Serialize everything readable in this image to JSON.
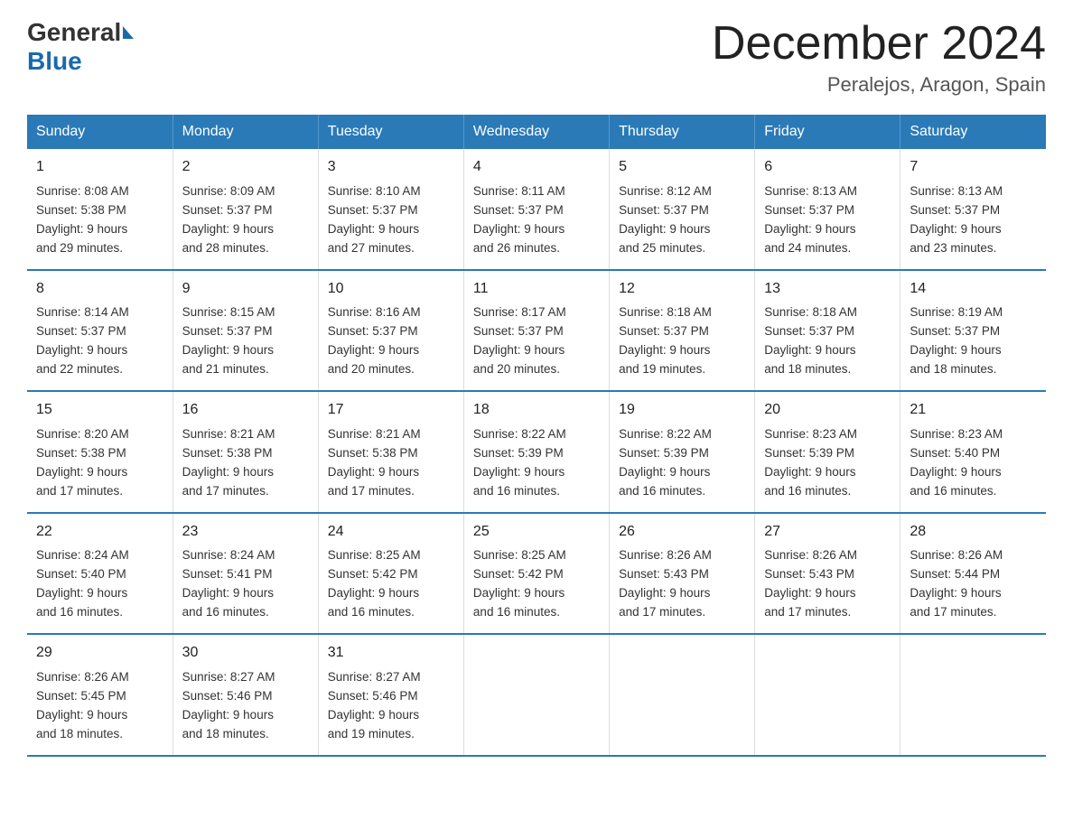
{
  "header": {
    "logo_general": "General",
    "logo_blue": "Blue",
    "month": "December 2024",
    "location": "Peralejos, Aragon, Spain"
  },
  "weekdays": [
    "Sunday",
    "Monday",
    "Tuesday",
    "Wednesday",
    "Thursday",
    "Friday",
    "Saturday"
  ],
  "weeks": [
    [
      {
        "day": "1",
        "sunrise": "8:08 AM",
        "sunset": "5:38 PM",
        "daylight": "9 hours and 29 minutes."
      },
      {
        "day": "2",
        "sunrise": "8:09 AM",
        "sunset": "5:37 PM",
        "daylight": "9 hours and 28 minutes."
      },
      {
        "day": "3",
        "sunrise": "8:10 AM",
        "sunset": "5:37 PM",
        "daylight": "9 hours and 27 minutes."
      },
      {
        "day": "4",
        "sunrise": "8:11 AM",
        "sunset": "5:37 PM",
        "daylight": "9 hours and 26 minutes."
      },
      {
        "day": "5",
        "sunrise": "8:12 AM",
        "sunset": "5:37 PM",
        "daylight": "9 hours and 25 minutes."
      },
      {
        "day": "6",
        "sunrise": "8:13 AM",
        "sunset": "5:37 PM",
        "daylight": "9 hours and 24 minutes."
      },
      {
        "day": "7",
        "sunrise": "8:13 AM",
        "sunset": "5:37 PM",
        "daylight": "9 hours and 23 minutes."
      }
    ],
    [
      {
        "day": "8",
        "sunrise": "8:14 AM",
        "sunset": "5:37 PM",
        "daylight": "9 hours and 22 minutes."
      },
      {
        "day": "9",
        "sunrise": "8:15 AM",
        "sunset": "5:37 PM",
        "daylight": "9 hours and 21 minutes."
      },
      {
        "day": "10",
        "sunrise": "8:16 AM",
        "sunset": "5:37 PM",
        "daylight": "9 hours and 20 minutes."
      },
      {
        "day": "11",
        "sunrise": "8:17 AM",
        "sunset": "5:37 PM",
        "daylight": "9 hours and 20 minutes."
      },
      {
        "day": "12",
        "sunrise": "8:18 AM",
        "sunset": "5:37 PM",
        "daylight": "9 hours and 19 minutes."
      },
      {
        "day": "13",
        "sunrise": "8:18 AM",
        "sunset": "5:37 PM",
        "daylight": "9 hours and 18 minutes."
      },
      {
        "day": "14",
        "sunrise": "8:19 AM",
        "sunset": "5:37 PM",
        "daylight": "9 hours and 18 minutes."
      }
    ],
    [
      {
        "day": "15",
        "sunrise": "8:20 AM",
        "sunset": "5:38 PM",
        "daylight": "9 hours and 17 minutes."
      },
      {
        "day": "16",
        "sunrise": "8:21 AM",
        "sunset": "5:38 PM",
        "daylight": "9 hours and 17 minutes."
      },
      {
        "day": "17",
        "sunrise": "8:21 AM",
        "sunset": "5:38 PM",
        "daylight": "9 hours and 17 minutes."
      },
      {
        "day": "18",
        "sunrise": "8:22 AM",
        "sunset": "5:39 PM",
        "daylight": "9 hours and 16 minutes."
      },
      {
        "day": "19",
        "sunrise": "8:22 AM",
        "sunset": "5:39 PM",
        "daylight": "9 hours and 16 minutes."
      },
      {
        "day": "20",
        "sunrise": "8:23 AM",
        "sunset": "5:39 PM",
        "daylight": "9 hours and 16 minutes."
      },
      {
        "day": "21",
        "sunrise": "8:23 AM",
        "sunset": "5:40 PM",
        "daylight": "9 hours and 16 minutes."
      }
    ],
    [
      {
        "day": "22",
        "sunrise": "8:24 AM",
        "sunset": "5:40 PM",
        "daylight": "9 hours and 16 minutes."
      },
      {
        "day": "23",
        "sunrise": "8:24 AM",
        "sunset": "5:41 PM",
        "daylight": "9 hours and 16 minutes."
      },
      {
        "day": "24",
        "sunrise": "8:25 AM",
        "sunset": "5:42 PM",
        "daylight": "9 hours and 16 minutes."
      },
      {
        "day": "25",
        "sunrise": "8:25 AM",
        "sunset": "5:42 PM",
        "daylight": "9 hours and 16 minutes."
      },
      {
        "day": "26",
        "sunrise": "8:26 AM",
        "sunset": "5:43 PM",
        "daylight": "9 hours and 17 minutes."
      },
      {
        "day": "27",
        "sunrise": "8:26 AM",
        "sunset": "5:43 PM",
        "daylight": "9 hours and 17 minutes."
      },
      {
        "day": "28",
        "sunrise": "8:26 AM",
        "sunset": "5:44 PM",
        "daylight": "9 hours and 17 minutes."
      }
    ],
    [
      {
        "day": "29",
        "sunrise": "8:26 AM",
        "sunset": "5:45 PM",
        "daylight": "9 hours and 18 minutes."
      },
      {
        "day": "30",
        "sunrise": "8:27 AM",
        "sunset": "5:46 PM",
        "daylight": "9 hours and 18 minutes."
      },
      {
        "day": "31",
        "sunrise": "8:27 AM",
        "sunset": "5:46 PM",
        "daylight": "9 hours and 19 minutes."
      },
      null,
      null,
      null,
      null
    ]
  ],
  "labels": {
    "sunrise": "Sunrise:",
    "sunset": "Sunset:",
    "daylight": "Daylight: 9 hours"
  }
}
